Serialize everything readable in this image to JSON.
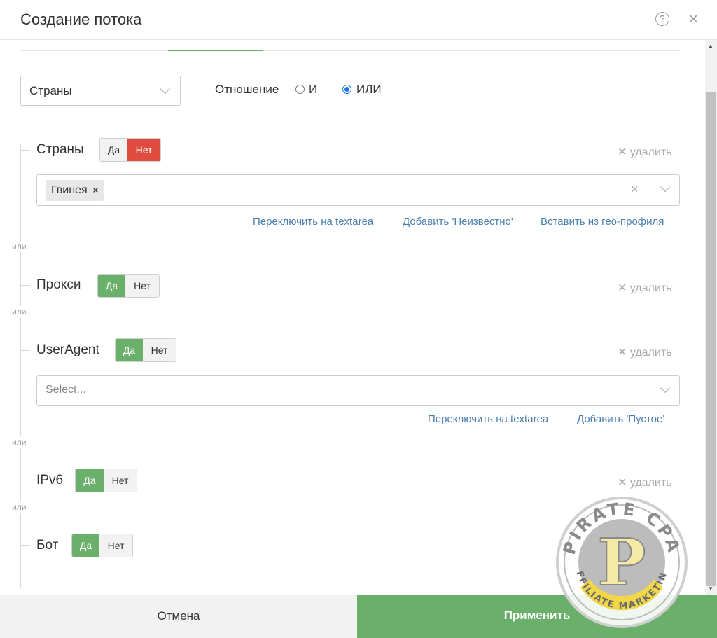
{
  "header": {
    "title": "Создание потока",
    "help_icon": "?",
    "close_icon": "×"
  },
  "filter_type_select": {
    "value": "Страны"
  },
  "relation": {
    "label": "Отношение",
    "option_and": "И",
    "option_or": "ИЛИ",
    "selected": "ИЛИ"
  },
  "or_label": "или",
  "delete_label": "✕ удалить",
  "toggle": {
    "yes": "Да",
    "no": "Нет"
  },
  "conditions": [
    {
      "label": "Страны",
      "active": "Нет",
      "chips": [
        "Гвинея"
      ],
      "links": [
        "Переключить на textarea",
        "Добавить 'Неизвестно'",
        "Вставить из гео-профиля"
      ]
    },
    {
      "label": "Прокси",
      "active": "Да"
    },
    {
      "label": "UserAgent",
      "active": "Да",
      "placeholder": "Select...",
      "links": [
        "Переключить на textarea",
        "Добавить 'Пустое'"
      ]
    },
    {
      "label": "IPv6",
      "active": "Да"
    },
    {
      "label": "Бот",
      "active": "Да"
    }
  ],
  "footer": {
    "cancel": "Отмена",
    "apply": "Применить"
  },
  "colors": {
    "green": "#6aaf6a",
    "red": "#e04b40",
    "link": "#4a7fb0"
  },
  "watermark": {
    "text": "PIRATE CPA",
    "subtext": "AFFILIATE MARKETING",
    "letter": "P"
  }
}
